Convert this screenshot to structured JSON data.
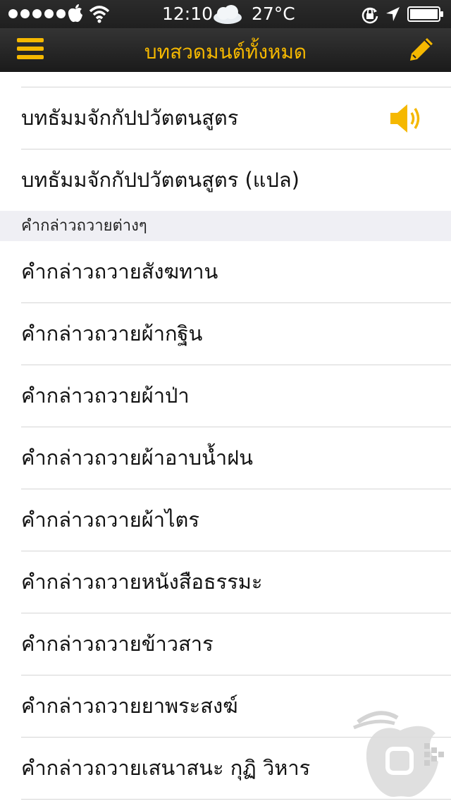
{
  "status_bar": {
    "time": "12:10",
    "temperature": "27°C"
  },
  "nav": {
    "title": "บทสวดมนต์ทั้งหมด"
  },
  "list": {
    "rows_before": [
      {
        "label": "บทธัมมจักกัปปวัตตนสูตร",
        "has_audio": true
      },
      {
        "label": "บทธัมมจักกัปปวัตตนสูตร (แปล)",
        "has_audio": false
      }
    ],
    "section": {
      "header": "คำกล่าวถวายต่างๆ",
      "items": [
        "คำกล่าวถวายสังฆทาน",
        "คำกล่าวถวายผ้ากฐิน",
        "คำกล่าวถวายผ้าป่า",
        "คำกล่าวถวายผ้าอาบน้ำฝน",
        "คำกล่าวถวายผ้าไตร",
        "คำกล่าวถวายหนังสือธรรมะ",
        "คำกล่าวถวายข้าวสาร",
        "คำกล่าวถวายยาพระสงฆ์",
        "คำกล่าวถวายเสนาสนะ กุฏิ วิหาร"
      ]
    }
  },
  "colors": {
    "accent": "#f5b800",
    "bar_bg": "#262626",
    "section_bg": "#efeff4",
    "separator": "#d5d5d5"
  }
}
